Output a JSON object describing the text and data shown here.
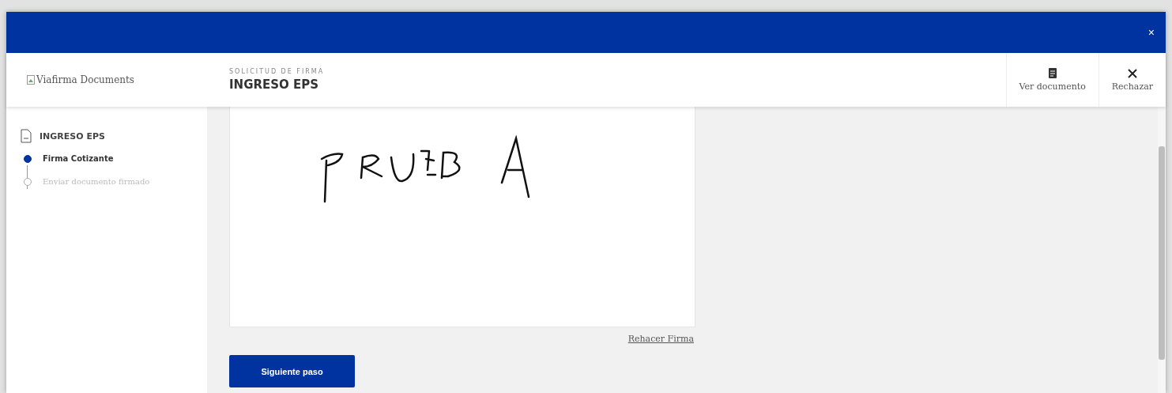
{
  "window": {
    "close": "×"
  },
  "header": {
    "logo_alt": "Viafirma Documents",
    "subtitle": "SOLICITUD DE FIRMA",
    "title": "INGRESO EPS",
    "actions": [
      {
        "kind": "document",
        "label": "Ver documento"
      },
      {
        "kind": "reject",
        "label": "Rechazar"
      }
    ]
  },
  "sidebar": {
    "document": "INGRESO EPS",
    "steps": [
      {
        "label": "Firma Cotizante",
        "active": true
      },
      {
        "label": "Enviar documento firmado",
        "active": false
      }
    ]
  },
  "signature": {
    "redo_link": "Rehacer Firma"
  },
  "next_button": "Siguiente paso"
}
